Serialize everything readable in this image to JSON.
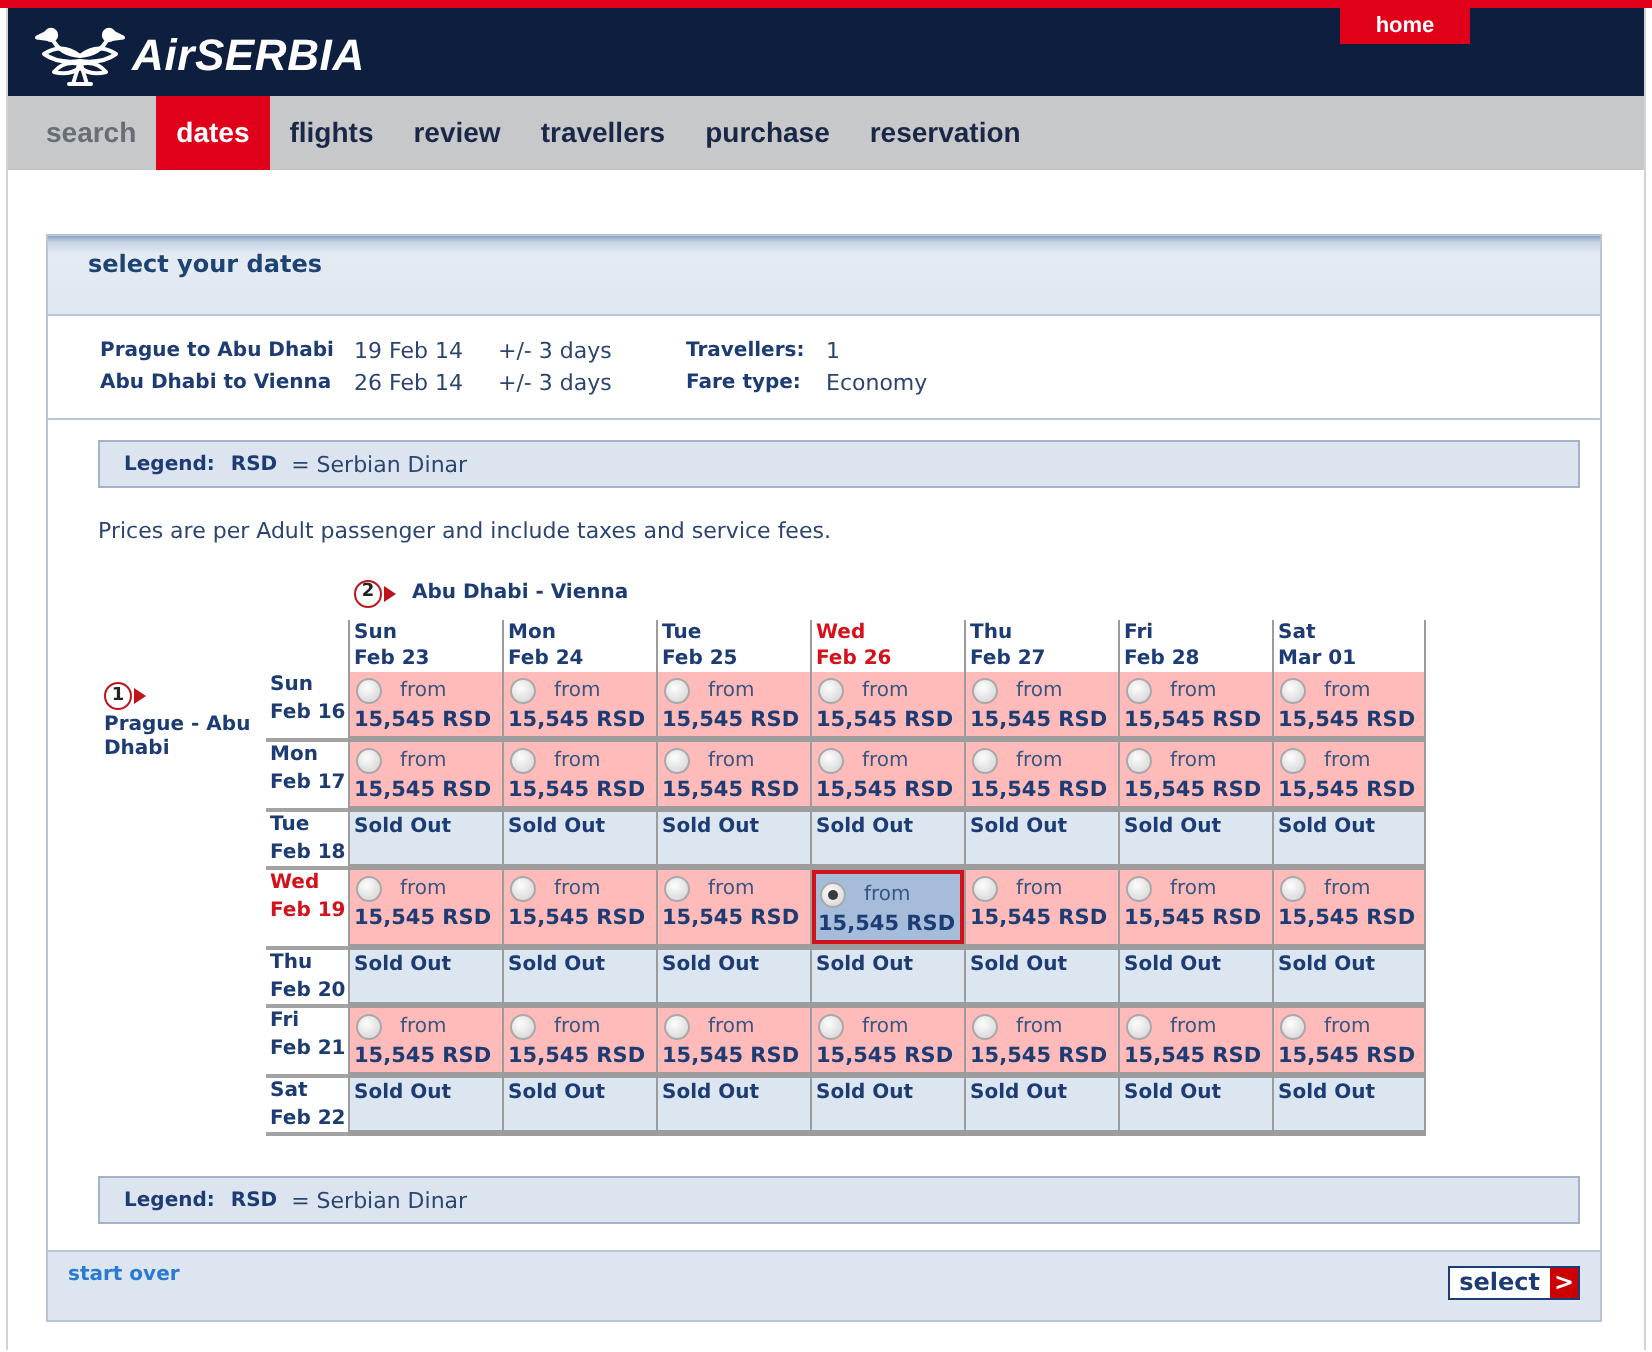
{
  "header": {
    "logo": "AirSERBIA",
    "home_link": "home"
  },
  "nav": {
    "tabs": [
      {
        "label": "search",
        "selected": false,
        "disabled": true
      },
      {
        "label": "dates",
        "selected": true,
        "disabled": false
      },
      {
        "label": "flights",
        "selected": false,
        "disabled": false
      },
      {
        "label": "review",
        "selected": false,
        "disabled": false
      },
      {
        "label": "travellers",
        "selected": false,
        "disabled": false
      },
      {
        "label": "purchase",
        "selected": false,
        "disabled": false
      },
      {
        "label": "reservation",
        "selected": false,
        "disabled": false
      }
    ]
  },
  "panel_title": "select your dates",
  "trips": [
    {
      "route": "Prague to Abu Dhabi",
      "date": "19 Feb 14",
      "flexibility": "+/- 3 days"
    },
    {
      "route": "Abu Dhabi to Vienna",
      "date": "26 Feb 14",
      "flexibility": "+/- 3 days"
    }
  ],
  "summary": [
    {
      "label": "Travellers:",
      "value": "1"
    },
    {
      "label": "Fare type:",
      "value": "Economy"
    }
  ],
  "legend_top": {
    "label": "Legend:",
    "code": "RSD",
    "meaning": "= Serbian Dinar"
  },
  "note": "Prices are per Adult passenger and include taxes and service fees.",
  "calendar": {
    "return": {
      "step": "2",
      "route": "Abu Dhabi - Vienna"
    },
    "outbound": {
      "step": "1",
      "route": "Prague - Abu Dhabi"
    },
    "columns": [
      {
        "day": "Sun",
        "date": "Feb 23",
        "highlighted": false
      },
      {
        "day": "Mon",
        "date": "Feb 24",
        "highlighted": false
      },
      {
        "day": "Tue",
        "date": "Feb 25",
        "highlighted": false
      },
      {
        "day": "Wed",
        "date": "Feb 26",
        "highlighted": true
      },
      {
        "day": "Thu",
        "date": "Feb 27",
        "highlighted": false
      },
      {
        "day": "Fri",
        "date": "Feb 28",
        "highlighted": false
      },
      {
        "day": "Sat",
        "date": "Mar 01",
        "highlighted": false
      }
    ],
    "rows": [
      {
        "day": "Sun",
        "date": "Feb 16",
        "highlighted": false,
        "cells": [
          {
            "kind": "fare",
            "selected": false,
            "from": "from",
            "price": "15,545 RSD"
          },
          {
            "kind": "fare",
            "selected": false,
            "from": "from",
            "price": "15,545 RSD"
          },
          {
            "kind": "fare",
            "selected": false,
            "from": "from",
            "price": "15,545 RSD"
          },
          {
            "kind": "fare",
            "selected": false,
            "from": "from",
            "price": "15,545 RSD"
          },
          {
            "kind": "fare",
            "selected": false,
            "from": "from",
            "price": "15,545 RSD"
          },
          {
            "kind": "fare",
            "selected": false,
            "from": "from",
            "price": "15,545 RSD"
          },
          {
            "kind": "fare",
            "selected": false,
            "from": "from",
            "price": "15,545 RSD"
          }
        ]
      },
      {
        "day": "Mon",
        "date": "Feb 17",
        "highlighted": false,
        "cells": [
          {
            "kind": "fare",
            "selected": false,
            "from": "from",
            "price": "15,545 RSD"
          },
          {
            "kind": "fare",
            "selected": false,
            "from": "from",
            "price": "15,545 RSD"
          },
          {
            "kind": "fare",
            "selected": false,
            "from": "from",
            "price": "15,545 RSD"
          },
          {
            "kind": "fare",
            "selected": false,
            "from": "from",
            "price": "15,545 RSD"
          },
          {
            "kind": "fare",
            "selected": false,
            "from": "from",
            "price": "15,545 RSD"
          },
          {
            "kind": "fare",
            "selected": false,
            "from": "from",
            "price": "15,545 RSD"
          },
          {
            "kind": "fare",
            "selected": false,
            "from": "from",
            "price": "15,545 RSD"
          }
        ]
      },
      {
        "day": "Tue",
        "date": "Feb 18",
        "highlighted": false,
        "cells": [
          {
            "kind": "sold_out",
            "text": "Sold Out"
          },
          {
            "kind": "sold_out",
            "text": "Sold Out"
          },
          {
            "kind": "sold_out",
            "text": "Sold Out"
          },
          {
            "kind": "sold_out",
            "text": "Sold Out"
          },
          {
            "kind": "sold_out",
            "text": "Sold Out"
          },
          {
            "kind": "sold_out",
            "text": "Sold Out"
          },
          {
            "kind": "sold_out",
            "text": "Sold Out"
          }
        ]
      },
      {
        "day": "Wed",
        "date": "Feb 19",
        "highlighted": true,
        "cells": [
          {
            "kind": "fare",
            "selected": false,
            "from": "from",
            "price": "15,545 RSD"
          },
          {
            "kind": "fare",
            "selected": false,
            "from": "from",
            "price": "15,545 RSD"
          },
          {
            "kind": "fare",
            "selected": false,
            "from": "from",
            "price": "15,545 RSD"
          },
          {
            "kind": "fare",
            "selected": true,
            "from": "from",
            "price": "15,545 RSD"
          },
          {
            "kind": "fare",
            "selected": false,
            "from": "from",
            "price": "15,545 RSD"
          },
          {
            "kind": "fare",
            "selected": false,
            "from": "from",
            "price": "15,545 RSD"
          },
          {
            "kind": "fare",
            "selected": false,
            "from": "from",
            "price": "15,545 RSD"
          }
        ]
      },
      {
        "day": "Thu",
        "date": "Feb 20",
        "highlighted": false,
        "cells": [
          {
            "kind": "sold_out",
            "text": "Sold Out"
          },
          {
            "kind": "sold_out",
            "text": "Sold Out"
          },
          {
            "kind": "sold_out",
            "text": "Sold Out"
          },
          {
            "kind": "sold_out",
            "text": "Sold Out"
          },
          {
            "kind": "sold_out",
            "text": "Sold Out"
          },
          {
            "kind": "sold_out",
            "text": "Sold Out"
          },
          {
            "kind": "sold_out",
            "text": "Sold Out"
          }
        ]
      },
      {
        "day": "Fri",
        "date": "Feb 21",
        "highlighted": false,
        "cells": [
          {
            "kind": "fare",
            "selected": false,
            "from": "from",
            "price": "15,545 RSD"
          },
          {
            "kind": "fare",
            "selected": false,
            "from": "from",
            "price": "15,545 RSD"
          },
          {
            "kind": "fare",
            "selected": false,
            "from": "from",
            "price": "15,545 RSD"
          },
          {
            "kind": "fare",
            "selected": false,
            "from": "from",
            "price": "15,545 RSD"
          },
          {
            "kind": "fare",
            "selected": false,
            "from": "from",
            "price": "15,545 RSD"
          },
          {
            "kind": "fare",
            "selected": false,
            "from": "from",
            "price": "15,545 RSD"
          },
          {
            "kind": "fare",
            "selected": false,
            "from": "from",
            "price": "15,545 RSD"
          }
        ]
      },
      {
        "day": "Sat",
        "date": "Feb 22",
        "highlighted": false,
        "cells": [
          {
            "kind": "sold_out",
            "text": "Sold Out"
          },
          {
            "kind": "sold_out",
            "text": "Sold Out"
          },
          {
            "kind": "sold_out",
            "text": "Sold Out"
          },
          {
            "kind": "sold_out",
            "text": "Sold Out"
          },
          {
            "kind": "sold_out",
            "text": "Sold Out"
          },
          {
            "kind": "sold_out",
            "text": "Sold Out"
          },
          {
            "kind": "sold_out",
            "text": "Sold Out"
          }
        ]
      }
    ]
  },
  "legend_bottom": {
    "label": "Legend:",
    "code": "RSD",
    "meaning": "= Serbian Dinar"
  },
  "footer": {
    "start_over": "start over",
    "select_button": {
      "label": "select",
      "arrow": ">"
    }
  }
}
